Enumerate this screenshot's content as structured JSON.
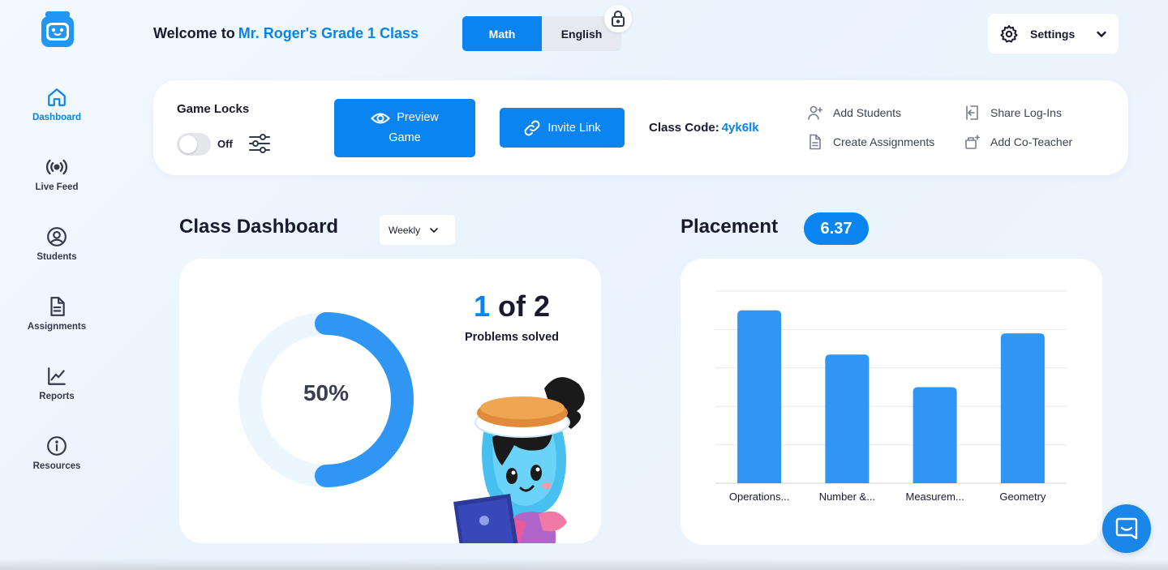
{
  "welcome": {
    "prefix": "Welcome to",
    "class_name": "Mr. Roger's Grade 1 Class"
  },
  "subjects": [
    {
      "label": "Math",
      "active": true
    },
    {
      "label": "English",
      "active": false,
      "locked": true
    }
  ],
  "settings": {
    "label": "Settings",
    "icon": "gear-icon"
  },
  "sidebar": {
    "items": [
      {
        "label": "Dashboard",
        "icon": "home-icon",
        "active": true
      },
      {
        "label": "Live Feed",
        "icon": "broadcast-icon"
      },
      {
        "label": "Students",
        "icon": "user-circle-icon"
      },
      {
        "label": "Assignments",
        "icon": "document-icon"
      },
      {
        "label": "Reports",
        "icon": "line-chart-icon"
      },
      {
        "label": "Resources",
        "icon": "info-icon"
      }
    ]
  },
  "toolbar": {
    "game_locks_title": "Game Locks",
    "game_locks_state": "Off",
    "preview_line1": "Preview",
    "preview_line2": "Game",
    "invite_label": "Invite Link",
    "class_code_label": "Class Code:",
    "class_code_value": "4yk6lk",
    "actions": [
      {
        "label": "Add Students",
        "icon": "add-user-icon"
      },
      {
        "label": "Create Assignments",
        "icon": "create-document-icon"
      },
      {
        "label": "Share Log-Ins",
        "icon": "share-login-icon"
      },
      {
        "label": "Add Co-Teacher",
        "icon": "add-co-teacher-icon"
      }
    ]
  },
  "dashboard": {
    "title": "Class Dashboard",
    "period": "Weekly",
    "percent_label": "50%",
    "percent": 0.5,
    "solved_count": "1",
    "solved_of": "of 2",
    "solved_label": "Problems solved"
  },
  "placement": {
    "title": "Placement",
    "score": "6.37"
  },
  "chart_data": {
    "type": "bar",
    "categories": [
      "Operations...",
      "Number &...",
      "Measurem...",
      "Geometry"
    ],
    "values": [
      4.5,
      3.35,
      2.5,
      3.9
    ],
    "ylim": [
      0,
      5
    ],
    "grid": true,
    "title": "",
    "xlabel": "",
    "ylabel": "",
    "bar_color": "#2f96f3"
  },
  "colors": {
    "accent": "#0a84f0",
    "accent_text": "#0a84e6",
    "donut_track": "#ecf6ff",
    "donut_fill": "#2f96f3"
  }
}
